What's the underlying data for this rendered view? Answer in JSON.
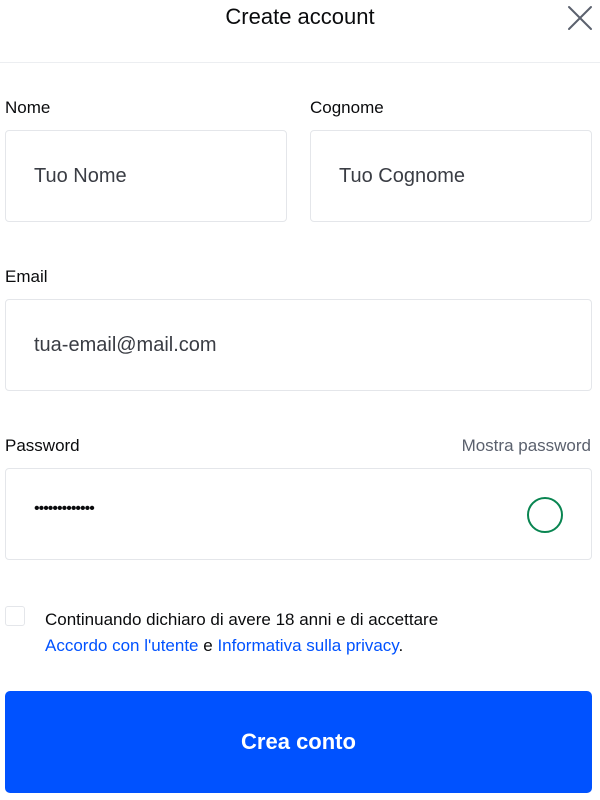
{
  "header": {
    "title": "Create account",
    "close_icon": "close-icon"
  },
  "form": {
    "first_name": {
      "label": "Nome",
      "placeholder": "Tuo Nome"
    },
    "last_name": {
      "label": "Cognome",
      "placeholder": "Tuo Cognome"
    },
    "email": {
      "label": "Email",
      "placeholder": "tua-email@mail.com"
    },
    "password": {
      "label": "Password",
      "show_label": "Mostra password",
      "masked_value": "•••••••••••••",
      "status_color": "#098551"
    },
    "consent": {
      "text_before": "Continuando dichiaro di avere 18 anni e di accettare",
      "user_agreement_link": "Accordo con l'utente",
      "conjunction": "e",
      "privacy_link": "Informativa sulla privacy",
      "period": ".",
      "checked": false
    },
    "submit_label": "Crea conto"
  },
  "colors": {
    "accent": "#0052ff",
    "border": "#e4e6ea",
    "muted_text": "#5b616e"
  }
}
